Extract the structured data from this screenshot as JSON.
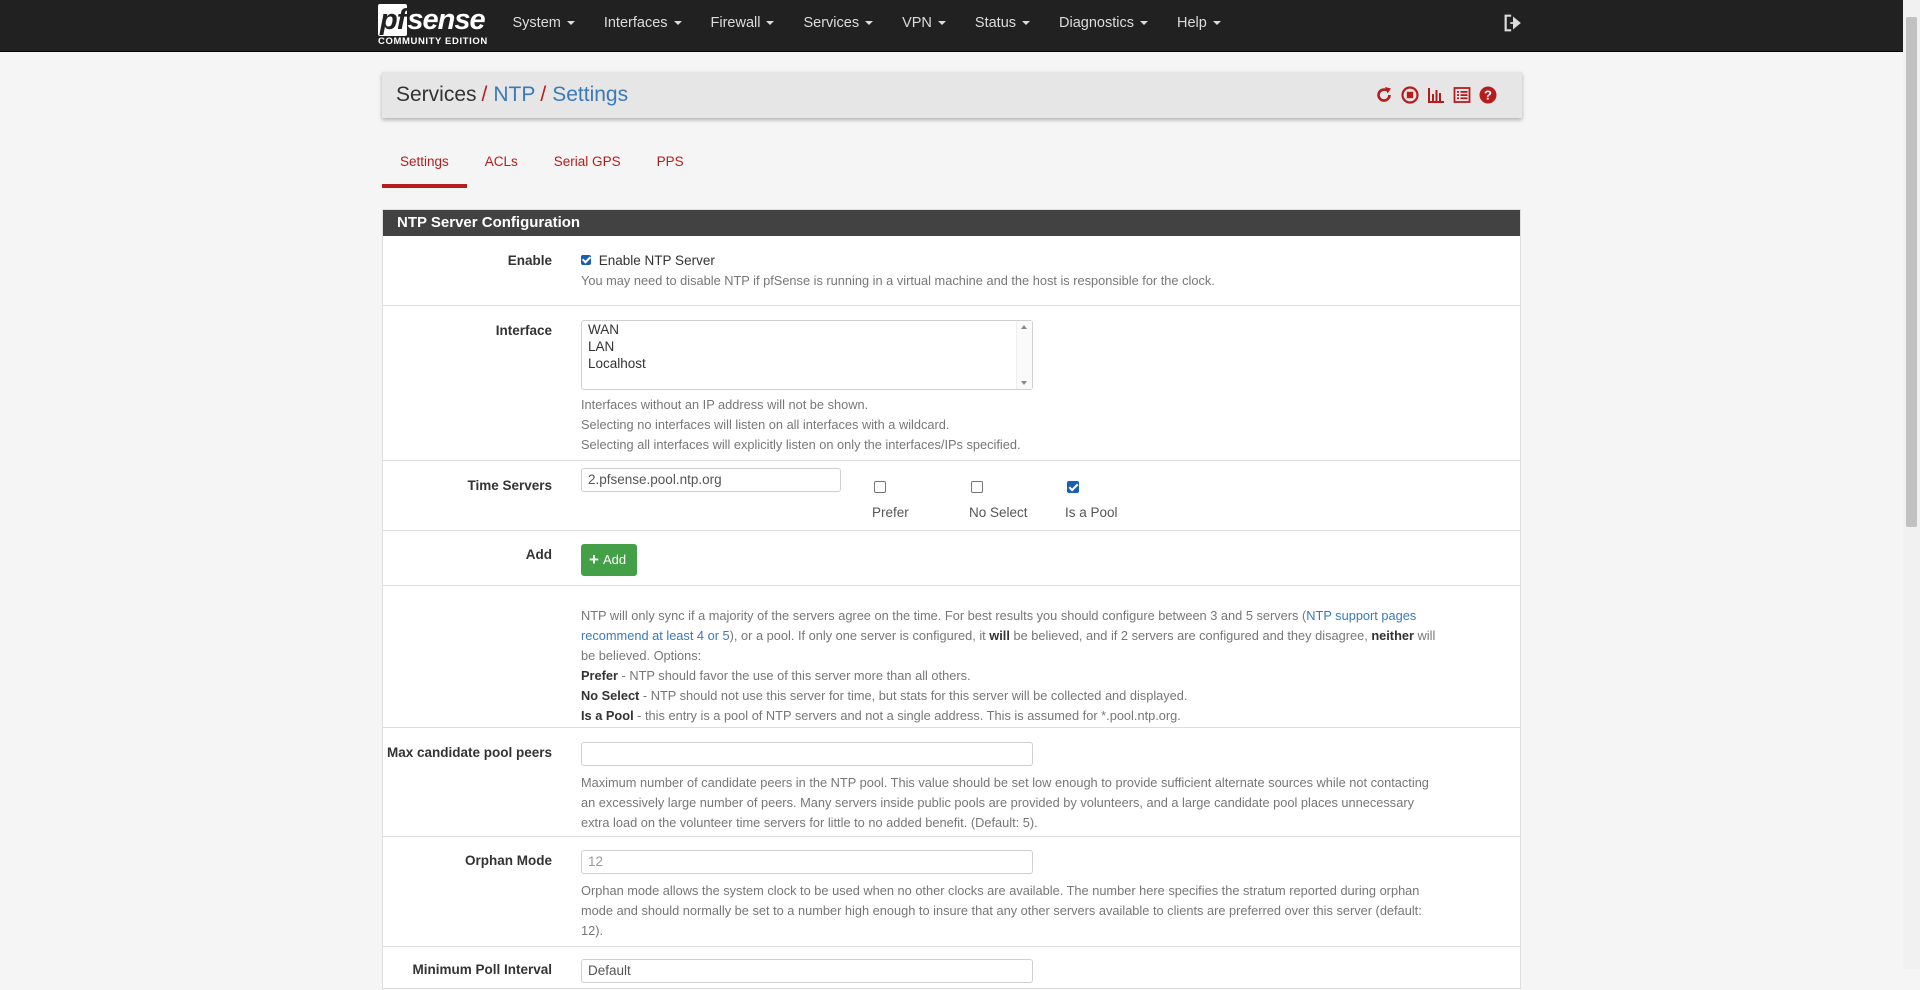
{
  "logo": {
    "word_pf": "pf",
    "word_rest": "sense",
    "edition": "COMMUNITY EDITION"
  },
  "nav": {
    "items": [
      {
        "label": "System"
      },
      {
        "label": "Interfaces"
      },
      {
        "label": "Firewall"
      },
      {
        "label": "Services"
      },
      {
        "label": "VPN"
      },
      {
        "label": "Status"
      },
      {
        "label": "Diagnostics"
      },
      {
        "label": "Help"
      }
    ]
  },
  "breadcrumb": {
    "part1": "Services",
    "sep": "/",
    "part2": "NTP",
    "part3": "Settings"
  },
  "header_icons": [
    "restart-service-icon",
    "stop-service-icon",
    "graph-icon",
    "log-icon",
    "help-icon"
  ],
  "tabs": [
    {
      "label": "Settings",
      "active": true
    },
    {
      "label": "ACLs"
    },
    {
      "label": "Serial GPS"
    },
    {
      "label": "PPS"
    }
  ],
  "panel": {
    "title": "NTP Server Configuration",
    "enable": {
      "label": "Enable",
      "checkbox_label": "Enable NTP Server",
      "checked": true,
      "help": "You may need to disable NTP if pfSense is running in a virtual machine and the host is responsible for the clock."
    },
    "interface": {
      "label": "Interface",
      "options": [
        "WAN",
        "LAN",
        "Localhost"
      ],
      "help1": "Interfaces without an IP address will not be shown.",
      "help2": "Selecting no interfaces will listen on all interfaces with a wildcard.",
      "help3": "Selecting all interfaces will explicitly listen on only the interfaces/IPs specified."
    },
    "time_servers": {
      "label": "Time Servers",
      "value": "2.pfsense.pool.ntp.org",
      "prefer": {
        "label": "Prefer",
        "checked": false
      },
      "noselect": {
        "label": "No Select",
        "checked": false
      },
      "pool": {
        "label": "Is a Pool",
        "checked": true
      }
    },
    "add": {
      "label": "Add",
      "button": "Add",
      "help_a": "NTP will only sync if a majority of the servers agree on the time. For best results you should configure between 3 and 5 servers (",
      "help_link1": "NTP support pages",
      "help_link2": "recommend at least 4 or 5",
      "help_b": "), or a pool. If only one server is configured, it ",
      "help_will": "will",
      "help_c": " be believed, and if 2 servers are configured and they disagree, ",
      "help_neither": "neither",
      "help_d": " will",
      "help_e": "be believed. Options:",
      "prefer_b": "Prefer",
      "prefer_t": " - NTP should favor the use of this server more than all others.",
      "noselect_b": "No Select",
      "noselect_t": " - NTP should not use this server for time, but stats for this server will be collected and displayed.",
      "pool_b": "Is a Pool",
      "pool_t": " - this entry is a pool of NTP servers and not a single address. This is assumed for *.pool.ntp.org."
    },
    "max_peers": {
      "label": "Max candidate pool peers",
      "value": "",
      "help1": "Maximum number of candidate peers in the NTP pool. This value should be set low enough to provide sufficient alternate sources while not contacting",
      "help2": "an excessively large number of peers. Many servers inside public pools are provided by volunteers, and a large candidate pool places unnecessary",
      "help3": "extra load on the volunteer time servers for little to no added benefit. (Default: 5)."
    },
    "orphan": {
      "label": "Orphan Mode",
      "placeholder": "12",
      "help1": "Orphan mode allows the system clock to be used when no other clocks are available. The number here specifies the stratum reported during orphan",
      "help2": "mode and should normally be set to a number high enough to insure that any other servers available to clients are preferred over this server (default:",
      "help3": "12)."
    },
    "min_poll": {
      "label": "Minimum Poll Interval",
      "value": "Default"
    }
  }
}
